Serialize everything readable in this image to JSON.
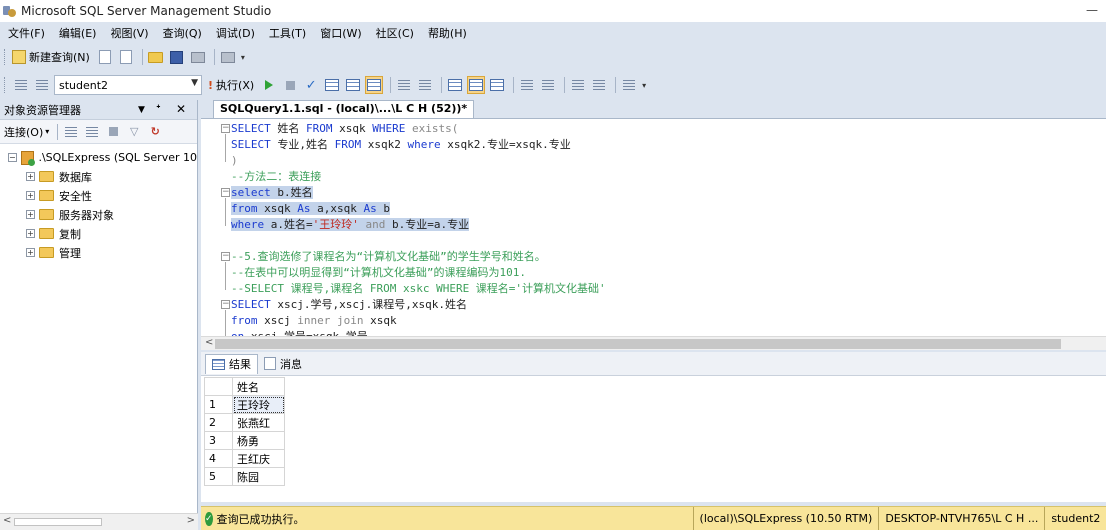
{
  "window": {
    "title": "Microsoft SQL Server Management Studio"
  },
  "menu": [
    "文件(F)",
    "编辑(E)",
    "视图(V)",
    "查询(Q)",
    "调试(D)",
    "工具(T)",
    "窗口(W)",
    "社区(C)",
    "帮助(H)"
  ],
  "toolbar1": {
    "new_query": "新建查询(N)"
  },
  "toolbar2": {
    "database": "student2",
    "execute": "执行(X)"
  },
  "object_explorer": {
    "title": "对象资源管理器",
    "connect": "连接(O)",
    "server": ".\\SQLExpress (SQL Server 10",
    "nodes": [
      "数据库",
      "安全性",
      "服务器对象",
      "复制",
      "管理"
    ]
  },
  "query_tab": {
    "title": "SQLQuery1.1.sql - (local)\\...\\L C H (52))*"
  },
  "editor": {
    "lines": [
      [
        {
          "t": "SELECT ",
          "c": "kw"
        },
        {
          "t": "姓名 ",
          "c": "nm"
        },
        {
          "t": "FROM ",
          "c": "kw"
        },
        {
          "t": "xsqk ",
          "c": "nm"
        },
        {
          "t": "WHERE ",
          "c": "kw"
        },
        {
          "t": "exists(",
          "c": "gray"
        }
      ],
      [
        {
          "t": "SELECT ",
          "c": "kw"
        },
        {
          "t": "专业,姓名 ",
          "c": "nm"
        },
        {
          "t": "FROM ",
          "c": "kw"
        },
        {
          "t": "xsqk2 ",
          "c": "nm"
        },
        {
          "t": "where ",
          "c": "kw"
        },
        {
          "t": "xsqk2.专业=xsqk.专业",
          "c": "nm"
        }
      ],
      [
        {
          "t": ")",
          "c": "gray"
        }
      ],
      [
        {
          "t": "--方法二：表连接",
          "c": "cmt"
        }
      ],
      [
        {
          "t": "select ",
          "c": "kw"
        },
        {
          "t": "b.姓名",
          "c": "nm"
        }
      ],
      [
        {
          "t": "from ",
          "c": "kw"
        },
        {
          "t": "xsqk ",
          "c": "nm"
        },
        {
          "t": "As ",
          "c": "kw"
        },
        {
          "t": "a,xsqk ",
          "c": "nm"
        },
        {
          "t": "As ",
          "c": "kw"
        },
        {
          "t": "b",
          "c": "nm"
        }
      ],
      [
        {
          "t": "where ",
          "c": "kw"
        },
        {
          "t": "a.姓名=",
          "c": "nm"
        },
        {
          "t": "'王玲玲'",
          "c": "str"
        },
        {
          "t": " and ",
          "c": "gray"
        },
        {
          "t": "b.专业=a.专业",
          "c": "nm"
        }
      ],
      [
        {
          "t": "",
          "c": "nm"
        }
      ],
      [
        {
          "t": "--5.查询选修了课程名为“计算机文化基础”的学生学号和姓名。",
          "c": "cmt"
        }
      ],
      [
        {
          "t": "--在表中可以明显得到“计算机文化基础”的课程编码为101.",
          "c": "cmt"
        }
      ],
      [
        {
          "t": "--SELECT 课程号,课程名 FROM xskc WHERE 课程名='计算机文化基础'",
          "c": "cmt"
        }
      ],
      [
        {
          "t": "SELECT ",
          "c": "kw"
        },
        {
          "t": "xscj.学号,xscj.课程号,xsqk.姓名",
          "c": "nm"
        }
      ],
      [
        {
          "t": "from ",
          "c": "kw"
        },
        {
          "t": "xscj ",
          "c": "nm"
        },
        {
          "t": "inner join ",
          "c": "gray"
        },
        {
          "t": "xsqk",
          "c": "nm"
        }
      ],
      [
        {
          "t": "on ",
          "c": "kw"
        },
        {
          "t": "xscj.学号=xsqk.学号",
          "c": "nm"
        }
      ]
    ]
  },
  "results_tabs": {
    "results": "结果",
    "messages": "消息"
  },
  "results": {
    "column": "姓名",
    "rows": [
      {
        "n": "1",
        "v": "王玲玲"
      },
      {
        "n": "2",
        "v": "张燕红"
      },
      {
        "n": "3",
        "v": "杨勇"
      },
      {
        "n": "4",
        "v": "王红庆"
      },
      {
        "n": "5",
        "v": "陈园"
      }
    ]
  },
  "status": {
    "message": "查询已成功执行。",
    "server": "(local)\\SQLExpress (10.50 RTM)",
    "user": "DESKTOP-NTVH765\\L C H ...",
    "db": "student2"
  }
}
